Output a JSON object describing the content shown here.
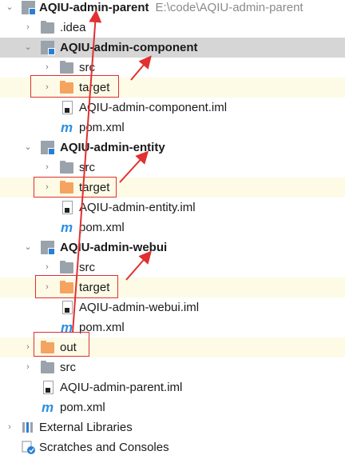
{
  "tree": {
    "root": {
      "name": "AQIU-admin-parent",
      "path": "E:\\code\\AQIU-admin-parent"
    },
    "idea": ".idea",
    "component": {
      "name": "AQIU-admin-component",
      "src": "src",
      "target": "target",
      "iml": "AQIU-admin-component.iml",
      "pom": "pom.xml"
    },
    "entity": {
      "name": "AQIU-admin-entity",
      "src": "src",
      "target": "target",
      "iml": "AQIU-admin-entity.iml",
      "pom": "pom.xml"
    },
    "webui": {
      "name": "AQIU-admin-webui",
      "src": "src",
      "target": "target",
      "iml": "AQIU-admin-webui.iml",
      "pom": "pom.xml"
    },
    "out": "out",
    "src": "src",
    "root_iml": "AQIU-admin-parent.iml",
    "root_pom": "pom.xml",
    "external_libraries": "External Libraries",
    "scratches": "Scratches and Consoles"
  },
  "colors": {
    "annotation": "#e03030",
    "selected_row": "#d6d6d6",
    "excluded_row": "#fdfbe6",
    "excluded_folder": "#f4a460"
  },
  "icons": {
    "expanded": "chevron-down-icon",
    "collapsed": "chevron-right-icon",
    "maven": "maven-icon"
  }
}
